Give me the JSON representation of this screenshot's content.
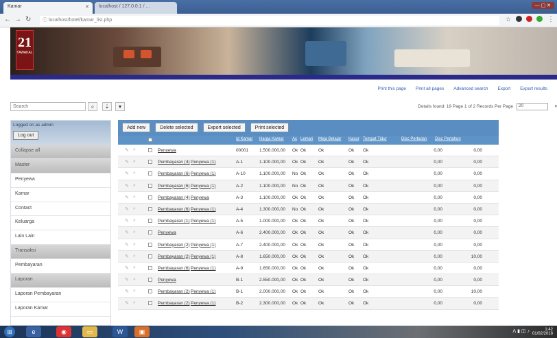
{
  "browser": {
    "tab_active": "Kamar",
    "tab_inactive": "localhost / 127.0.0.1 / ...",
    "url": "localhost/hotel/kamar_list.php"
  },
  "banner": {
    "logo_number": "21",
    "logo_text": "TAWAKAL"
  },
  "toplinks": [
    "Print this page",
    "Print all pages",
    "Advanced search",
    "Export",
    "Export results"
  ],
  "search": {
    "placeholder": "Search"
  },
  "pager": {
    "text": "Details found: 19  Page 1 of 2  Records Per Page",
    "per_page": "20"
  },
  "sidebar": {
    "logged_in": "Logged on as admin",
    "logout": "Log out",
    "items": [
      {
        "label": "Collapse all",
        "group": true
      },
      {
        "label": "Master",
        "group": true
      },
      {
        "label": "Penyewa",
        "group": false
      },
      {
        "label": "Kamar",
        "group": false
      },
      {
        "label": "Contact",
        "group": false
      },
      {
        "label": "Keluarga",
        "group": false
      },
      {
        "label": "Lain Lain",
        "group": false
      },
      {
        "label": "Transaksi",
        "group": true
      },
      {
        "label": "Pembayaran",
        "group": false
      },
      {
        "label": "Laporan",
        "group": true
      },
      {
        "label": "Laporan Pembayaran",
        "group": false
      },
      {
        "label": "Laporan Kamar",
        "group": false
      }
    ]
  },
  "toolbar": {
    "add": "Add new",
    "delete": "Delete selected",
    "export": "Export selected",
    "print": "Print selected"
  },
  "columns": [
    "Id Kamar",
    "Harga Kamar",
    "Ac",
    "Lemari",
    "Meja Belajar",
    "Kasur",
    "Tempat Tidur",
    "Disc Perbulan",
    "Disc Pertahun"
  ],
  "rows": [
    {
      "links": [
        "Penyewa"
      ],
      "id": "00001",
      "harga": "1.500.000,00",
      "ac": "Ok",
      "lemari": "Ok",
      "meja": "Ok",
      "kasur": "Ok",
      "tempat": "Ok",
      "disc_bulan": "0,00",
      "disc_tahun": "0,00"
    },
    {
      "links": [
        "Pembayaran (4)",
        "Penyewa (1)"
      ],
      "id": "A-1",
      "harga": "1.100.000,00",
      "ac": "Ok",
      "lemari": "Ok",
      "meja": "Ok",
      "kasur": "Ok",
      "tempat": "Ok",
      "disc_bulan": "0,00",
      "disc_tahun": "0,00"
    },
    {
      "links": [
        "Pembayaran (6)",
        "Penyewa (1)"
      ],
      "id": "A-10",
      "harga": "1.100.000,00",
      "ac": "No",
      "lemari": "Ok",
      "meja": "Ok",
      "kasur": "Ok",
      "tempat": "Ok",
      "disc_bulan": "0,00",
      "disc_tahun": "0,00"
    },
    {
      "links": [
        "Pembayaran (6)",
        "Penyewa (1)"
      ],
      "id": "A-2",
      "harga": "1.100.000,00",
      "ac": "No",
      "lemari": "Ok",
      "meja": "Ok",
      "kasur": "Ok",
      "tempat": "Ok",
      "disc_bulan": "0,00",
      "disc_tahun": "0,00"
    },
    {
      "links": [
        "Pembayaran (4)",
        "Penyewa"
      ],
      "id": "A-3",
      "harga": "1.100.000,00",
      "ac": "Ok",
      "lemari": "Ok",
      "meja": "Ok",
      "kasur": "Ok",
      "tempat": "Ok",
      "disc_bulan": "0,00",
      "disc_tahun": "0,00"
    },
    {
      "links": [
        "Pembayaran (6)",
        "Penyewa (1)"
      ],
      "id": "A-4",
      "harga": "1.300.000,00",
      "ac": "No",
      "lemari": "Ok",
      "meja": "Ok",
      "kasur": "Ok",
      "tempat": "Ok",
      "disc_bulan": "0,00",
      "disc_tahun": "0,00"
    },
    {
      "links": [
        "Pembayaran (1)",
        "Penyewa (1)"
      ],
      "id": "A-5",
      "harga": "1.000.000,00",
      "ac": "Ok",
      "lemari": "Ok",
      "meja": "Ok",
      "kasur": "Ok",
      "tempat": "Ok",
      "disc_bulan": "0,00",
      "disc_tahun": "0,00"
    },
    {
      "links": [
        "Penyewa"
      ],
      "id": "A-6",
      "harga": "2.400.000,00",
      "ac": "Ok",
      "lemari": "Ok",
      "meja": "Ok",
      "kasur": "Ok",
      "tempat": "Ok",
      "disc_bulan": "0,00",
      "disc_tahun": "0,00"
    },
    {
      "links": [
        "Pembayaran (2)",
        "Penyewa (1)"
      ],
      "id": "A-7",
      "harga": "2.400.000,00",
      "ac": "Ok",
      "lemari": "Ok",
      "meja": "Ok",
      "kasur": "Ok",
      "tempat": "Ok",
      "disc_bulan": "0,00",
      "disc_tahun": "0,00"
    },
    {
      "links": [
        "Pembayaran (2)",
        "Penyewa (1)"
      ],
      "id": "A-8",
      "harga": "1.650.000,00",
      "ac": "Ok",
      "lemari": "Ok",
      "meja": "Ok",
      "kasur": "Ok",
      "tempat": "Ok",
      "disc_bulan": "0,00",
      "disc_tahun": "10,00"
    },
    {
      "links": [
        "Pembayaran (6)",
        "Penyewa (1)"
      ],
      "id": "A-9",
      "harga": "1.650.000,00",
      "ac": "Ok",
      "lemari": "Ok",
      "meja": "Ok",
      "kasur": "Ok",
      "tempat": "Ok",
      "disc_bulan": "0,00",
      "disc_tahun": "0,00"
    },
    {
      "links": [
        "Penyewa"
      ],
      "id": "B-1",
      "harga": "2.550.000,00",
      "ac": "Ok",
      "lemari": "Ok",
      "meja": "Ok",
      "kasur": "Ok",
      "tempat": "Ok",
      "disc_bulan": "0,00",
      "disc_tahun": "0,00"
    },
    {
      "links": [
        "Pembayaran (2)",
        "Penyewa (1)"
      ],
      "id": "B-1",
      "harga": "2.000.000,00",
      "ac": "Ok",
      "lemari": "Ok",
      "meja": "Ok",
      "kasur": "Ok",
      "tempat": "Ok",
      "disc_bulan": "0,00",
      "disc_tahun": "10,00"
    },
    {
      "links": [
        "Pembayaran (2)",
        "Penyewa (1)"
      ],
      "id": "B-2",
      "harga": "2.300.000,00",
      "ac": "Ok",
      "lemari": "Ok",
      "meja": "Ok",
      "kasur": "Ok",
      "tempat": "Ok",
      "disc_bulan": "0,00",
      "disc_tahun": "0,00"
    }
  ],
  "taskbar": {
    "clock_time": "1:42",
    "clock_date": "01/02/2018"
  }
}
